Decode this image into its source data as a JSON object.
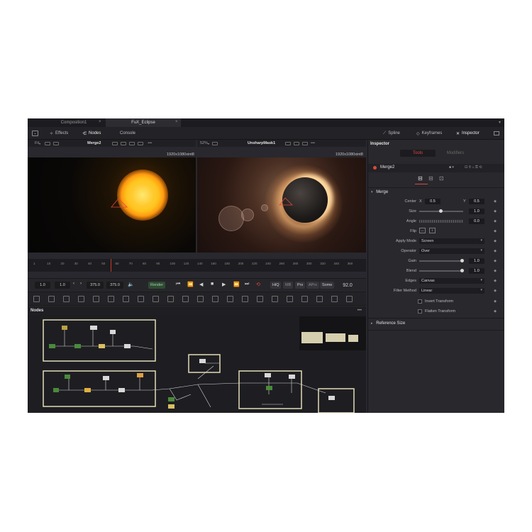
{
  "tabs": [
    {
      "label": "Composition1",
      "active": false
    },
    {
      "label": "FuX_Eclipse",
      "active": true
    }
  ],
  "toolbar": {
    "effects": "Effects",
    "nodes": "Nodes",
    "console": "Console",
    "spline": "Spline",
    "keyframes": "Keyframes",
    "inspector": "Inspector"
  },
  "viewer_left": {
    "fit": "Fit",
    "node": "Merge2",
    "zoom": "52%",
    "resolution": "1920x1080xint8"
  },
  "viewer_right": {
    "node": "UnsharpMask1",
    "resolution": "1920x1080xint8"
  },
  "timeline": {
    "ticks": [
      "1",
      "10",
      "20",
      "30",
      "40",
      "50",
      "60",
      "70",
      "80",
      "90",
      "100",
      "120",
      "140",
      "160",
      "180",
      "200",
      "220",
      "240",
      "260",
      "280",
      "300",
      "320",
      "340",
      "360"
    ]
  },
  "transport": {
    "start": "1.0",
    "render_start": "1.0",
    "render_end": "375.0",
    "end": "375.0",
    "render": "Render",
    "hiq": "HiQ",
    "mb": "MB",
    "prx": "Prx",
    "aprx": "APrx",
    "some": "Some",
    "current_frame": "92.0"
  },
  "nodes_panel": {
    "title": "Nodes"
  },
  "inspector": {
    "title": "Inspector",
    "tabs": {
      "tools": "Tools",
      "modifiers": "Modifiers"
    },
    "tool_name": "Merge2",
    "section_merge": "Merge",
    "section_reference": "Reference Size",
    "center_label": "Center",
    "center_x_label": "X",
    "center_x": "0.5",
    "center_y_label": "Y",
    "center_y": "0.5",
    "size_label": "Size",
    "size": "1.0",
    "angle_label": "Angle",
    "angle": "0.0",
    "flip_label": "Flip",
    "apply_mode_label": "Apply Mode",
    "apply_mode": "Screen",
    "operator_label": "Operator",
    "operator": "Over",
    "gain_label": "Gain",
    "gain": "1.0",
    "blend_label": "Blend",
    "blend": "1.0",
    "edges_label": "Edges",
    "edges": "Canvas",
    "filter_label": "Filter Method",
    "filter": "Linear",
    "invert_transform": "Invert Transform",
    "flatten_transform": "Flatten Transform"
  },
  "colors": {
    "accent_red": "#e0473a",
    "background": "#28282e"
  }
}
